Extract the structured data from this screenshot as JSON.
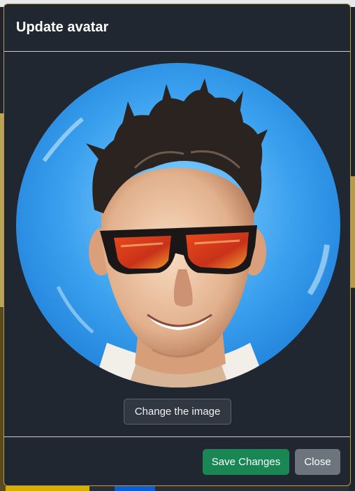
{
  "modal": {
    "title": "Update avatar",
    "avatar_alt": "Stylized cartoon portrait of a smiling man with spiky dark hair wearing red-lensed sunglasses on a blue background",
    "change_image_label": "Change the image",
    "save_label": "Save Changes",
    "close_label": "Close"
  },
  "colors": {
    "modal_bg": "#212730",
    "modal_border": "#b69b49",
    "save_button": "#198754",
    "close_button": "#6c757d",
    "avatar_background": "#3aa0ee"
  }
}
